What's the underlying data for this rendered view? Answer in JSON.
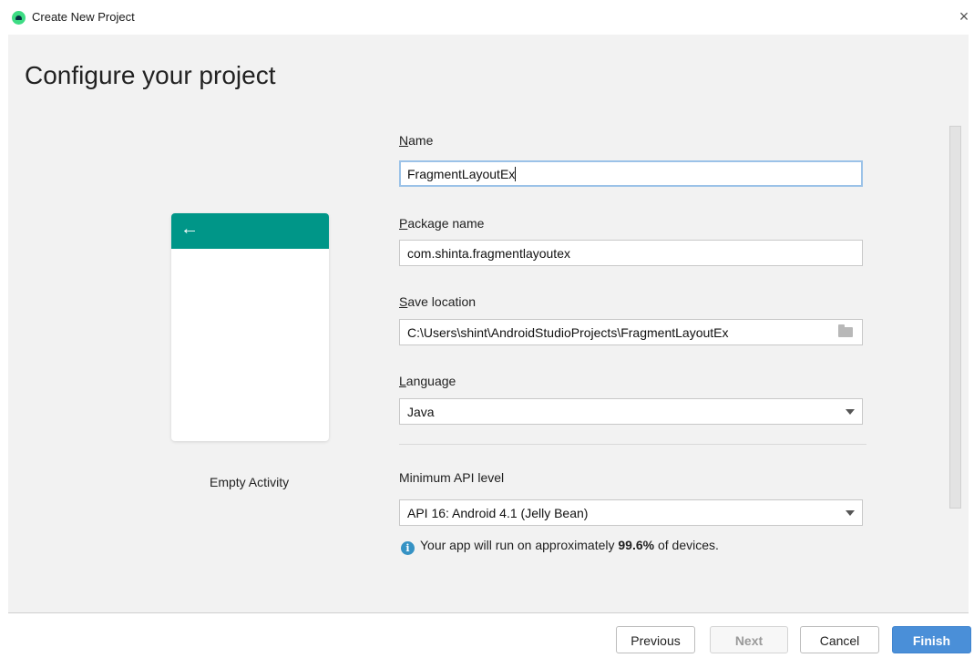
{
  "window": {
    "title": "Create New Project",
    "close_glyph": "×"
  },
  "header": {
    "title": "Configure your project"
  },
  "preview": {
    "back_glyph": "←",
    "template_label": "Empty Activity",
    "toolbar_color": "#009688"
  },
  "form": {
    "name": {
      "label_first": "N",
      "label_rest": "ame",
      "value": "FragmentLayoutEx"
    },
    "package": {
      "label_first": "P",
      "label_rest": "ackage name",
      "value": "com.shinta.fragmentlayoutex"
    },
    "location": {
      "label_first": "S",
      "label_rest": "ave location",
      "value": "C:\\Users\\shint\\AndroidStudioProjects\\FragmentLayoutEx",
      "icon": "folder-icon"
    },
    "language": {
      "label_first": "L",
      "label_rest": "anguage",
      "value": "Java"
    },
    "min_api": {
      "label": "Minimum API level",
      "value": "API 16: Android 4.1 (Jelly Bean)"
    },
    "info": {
      "prefix": "Your app will run on approximately ",
      "percent": "99.6%",
      "suffix": " of devices.",
      "icon": "info-icon"
    }
  },
  "buttons": {
    "previous": "Previous",
    "next": "Next",
    "cancel": "Cancel",
    "finish": "Finish"
  },
  "colors": {
    "accent": "#4a8fd8",
    "focus_border": "#9bc2e8",
    "info": "#3592c4"
  }
}
